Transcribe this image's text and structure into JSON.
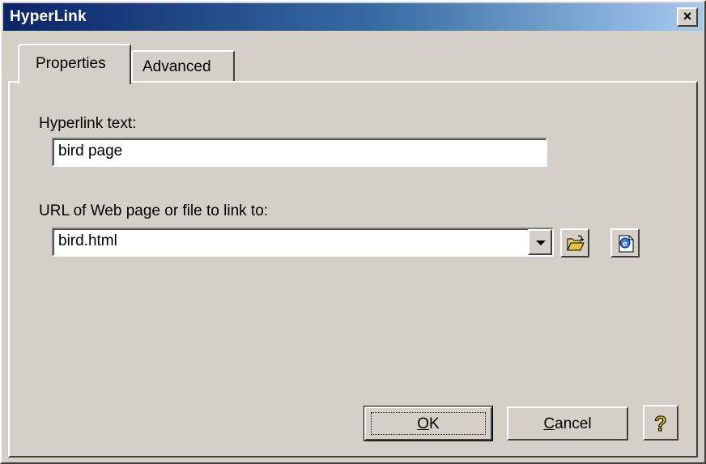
{
  "window": {
    "title": "HyperLink",
    "close_label": "×"
  },
  "tabs": [
    {
      "label": "Properties",
      "selected": true
    },
    {
      "label": "Advanced",
      "selected": false
    }
  ],
  "form": {
    "hyperlink_text_label": "Hyperlink text:",
    "hyperlink_text_value": "bird page",
    "url_label": "URL of Web page or file to link to:",
    "url_value": "bird.html"
  },
  "icons": {
    "browse_file": "folder-open-icon",
    "browse_web": "web-page-icon",
    "help": "question-mark-icon"
  },
  "buttons": {
    "ok_underline": "O",
    "ok_rest": "K",
    "cancel_underline": "C",
    "cancel_rest": "ancel",
    "help_label": "?"
  },
  "colors": {
    "titlebar_start": "#0a246a",
    "titlebar_end": "#a6caf0",
    "face": "#d4d0c8"
  }
}
